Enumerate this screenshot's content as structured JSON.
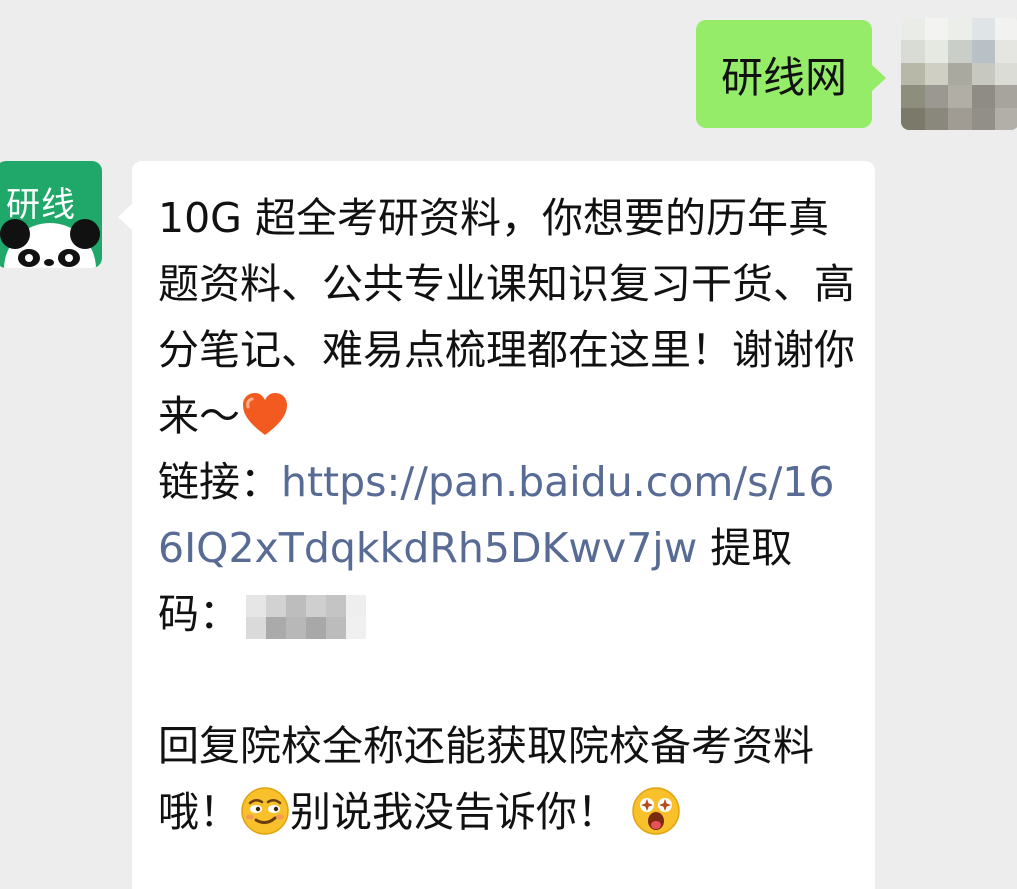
{
  "outgoing": {
    "text": "研线网"
  },
  "incoming": {
    "avatar_text": "研线",
    "paragraph1": "10G 超全考研资料，你想要的历年真题资料、公共专业课知识复习干货、高分笔记、难易点梳理都在这里！谢谢你来～",
    "link_label": "链接：",
    "link_url": "https://pan.baidu.com/s/166IQ2xTdqkkdRh5DKwv7jw",
    "code_label": " 提取码：",
    "paragraph2_part1": "回复院校全称还能获取院校备考资料哦！",
    "paragraph2_part2": "别说我没告诉你！",
    "icons": [
      "heart-emoji",
      "smirk-emoji",
      "star-eyes-emoji"
    ]
  },
  "colors": {
    "background": "#ededed",
    "outgoing_bubble": "#95ec69",
    "incoming_bubble": "#ffffff",
    "link": "#576b95",
    "bot_avatar": "#1fa86a"
  }
}
